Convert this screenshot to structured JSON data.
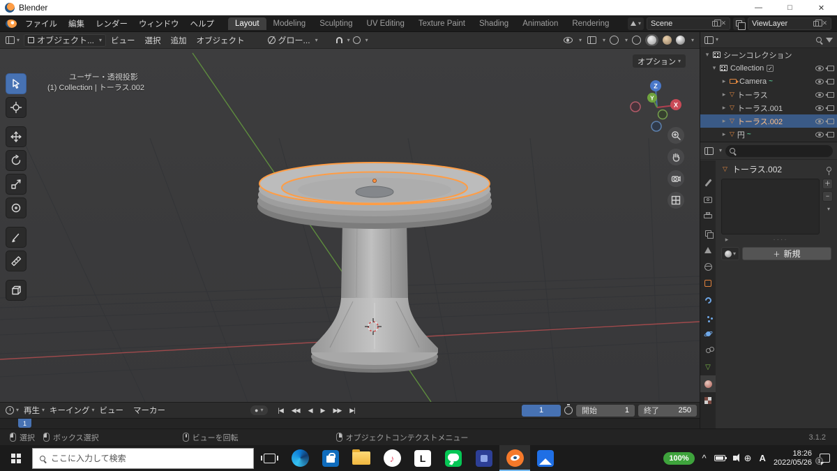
{
  "titlebar": {
    "title": "Blender",
    "controls": {
      "minimize": "—",
      "maximize": "□",
      "close": "✕"
    }
  },
  "menubar": {
    "menus": [
      "ファイル",
      "編集",
      "レンダー",
      "ウィンドウ",
      "ヘルプ"
    ],
    "workspaces": [
      "Layout",
      "Modeling",
      "Sculpting",
      "UV Editing",
      "Texture Paint",
      "Shading",
      "Animation",
      "Rendering"
    ],
    "active_workspace": "Layout",
    "scene_field": "Scene",
    "viewlayer_field": "ViewLayer"
  },
  "viewport_header": {
    "mode": "オブジェクト...",
    "menus": [
      "ビュー",
      "選択",
      "追加",
      "オブジェクト"
    ],
    "orientation": "グロー...",
    "options": "オプション"
  },
  "viewport": {
    "view_label": "ユーザー・透視投影",
    "context_label": "(1) Collection | トーラス.002",
    "gizmo": {
      "x": "X",
      "y": "Y",
      "z": "Z"
    }
  },
  "outliner": {
    "root": "シーンコレクション",
    "rows": [
      {
        "label": "Collection"
      },
      {
        "label": "Camera"
      },
      {
        "label": "トーラス"
      },
      {
        "label": "トーラス.001"
      },
      {
        "label": "トーラス.002"
      },
      {
        "label": "円"
      }
    ]
  },
  "properties": {
    "object_name": "トーラス.002",
    "new_button": "新規"
  },
  "timeline": {
    "menus": [
      "再生",
      "キーイング",
      "ビュー",
      "マーカー"
    ],
    "record": "●",
    "transport": {
      "to_start": "|◀",
      "prev_key": "◀◀",
      "prev": "◀",
      "play": "▶",
      "next_key": "▶▶",
      "to_end": "▶|"
    },
    "current_frame": "1",
    "start_label": "開始",
    "start_value": "1",
    "end_label": "終了",
    "end_value": "250",
    "marker": "1"
  },
  "statusbar": {
    "hints": [
      "選択",
      "ボックス選択",
      "ビューを回転",
      "オブジェクトコンテクストメニュー"
    ],
    "version": "3.1.2"
  },
  "taskbar": {
    "search_placeholder": "ここに入力して検索",
    "battery": "100%",
    "ime": "A",
    "time": "18:26",
    "date": "2022/05/26",
    "badge": "1",
    "l_label": "L",
    "music_note": "♪"
  },
  "glyphs": {
    "chevron": "▾",
    "expand": "▸",
    "mesh": "▽",
    "check": "✓",
    "plus": "＋",
    "minus": "−",
    "wave": "~",
    "dots": "····",
    "globe": "⊕",
    "caret": "^"
  }
}
